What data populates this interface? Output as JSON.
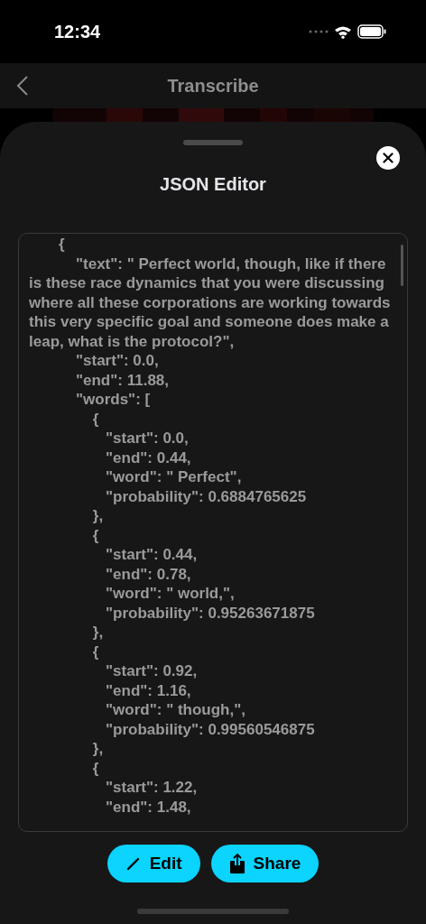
{
  "status_bar": {
    "time": "12:34"
  },
  "nav_bar": {
    "title": "Transcribe"
  },
  "sheet": {
    "title": "JSON Editor",
    "editor": {
      "content": "       {\n           \"text\": \" Perfect world, though, like if there is these race dynamics that you were discussing where all these corporations are working towards this very specific goal and someone does make a leap, what is the protocol?\",\n           \"start\": 0.0,\n           \"end\": 11.88,\n           \"words\": [\n               {\n                  \"start\": 0.0,\n                  \"end\": 0.44,\n                  \"word\": \" Perfect\",\n                  \"probability\": 0.6884765625\n               },\n               {\n                  \"start\": 0.44,\n                  \"end\": 0.78,\n                  \"word\": \" world,\",\n                  \"probability\": 0.95263671875\n               },\n               {\n                  \"start\": 0.92,\n                  \"end\": 1.16,\n                  \"word\": \" though,\",\n                  \"probability\": 0.99560546875\n               },\n               {\n                  \"start\": 1.22,\n                  \"end\": 1.48,"
    },
    "buttons": [
      {
        "label": "Edit",
        "kind": "edit"
      },
      {
        "label": "Share",
        "kind": "share"
      }
    ]
  }
}
